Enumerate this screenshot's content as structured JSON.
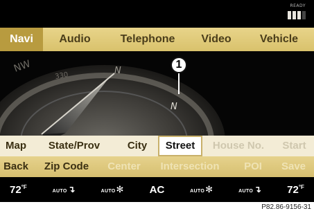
{
  "status": {
    "signal_label": "READY"
  },
  "main_menu": {
    "items": [
      "Navi",
      "Audio",
      "Telephone",
      "Video",
      "Vehicle"
    ],
    "active": "Navi"
  },
  "map": {
    "compass_labels": [
      "NW",
      "330",
      "N"
    ],
    "position_label": "N",
    "callout_number": "1"
  },
  "entry_row": {
    "map": "Map",
    "state_prov": "State/Prov",
    "city": "City",
    "street": "Street",
    "house_no": "House No.",
    "start": "Start",
    "selected": "Street",
    "disabled": [
      "House No.",
      "Start"
    ]
  },
  "action_row": {
    "back": "Back",
    "zip_code": "Zip Code",
    "center": "Center",
    "intersection": "Intersection",
    "poi": "POI",
    "save": "Save",
    "disabled": [
      "Center",
      "Intersection",
      "POI",
      "Save"
    ]
  },
  "climate": {
    "left_temp": "72",
    "right_temp": "72",
    "temp_unit": "°F",
    "auto_label": "AUTO",
    "ac_label": "AC"
  },
  "reference_code": "P82.86-9156-31"
}
